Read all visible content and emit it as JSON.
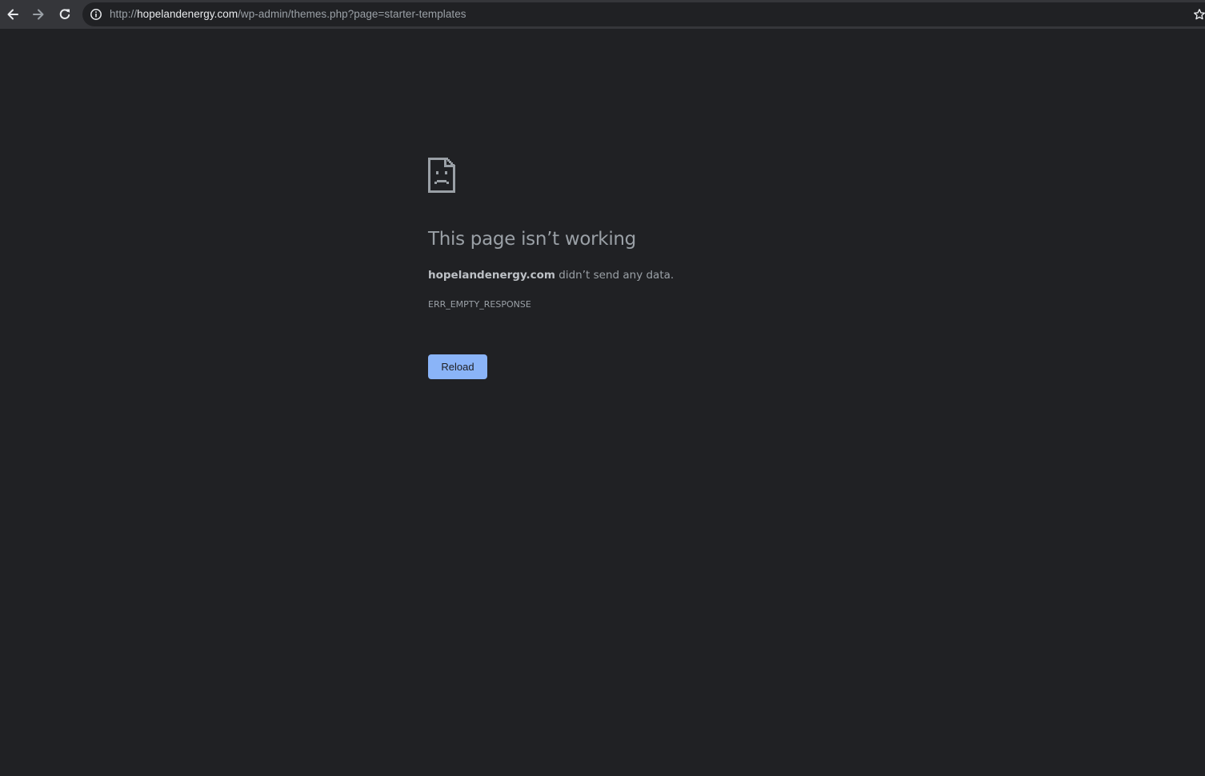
{
  "browser": {
    "back_icon": "arrow-left-icon",
    "forward_icon": "arrow-right-icon",
    "reload_icon": "reload-icon",
    "site_info_icon": "info-icon",
    "bookmark_icon": "star-icon",
    "url": {
      "scheme": "http://",
      "host": "hopelandenergy.com",
      "path": "/wp-admin/themes.php?page=starter-templates"
    }
  },
  "error_page": {
    "icon": "sad-page-icon",
    "title": "This page isn’t working",
    "host": "hopelandenergy.com",
    "message": " didn’t send any data.",
    "error_code": "ERR_EMPTY_RESPONSE",
    "reload_label": "Reload"
  },
  "colors": {
    "background": "#202124",
    "toolbar": "#35363a",
    "text": "#9aa0a6",
    "button": "#8ab4f8"
  }
}
